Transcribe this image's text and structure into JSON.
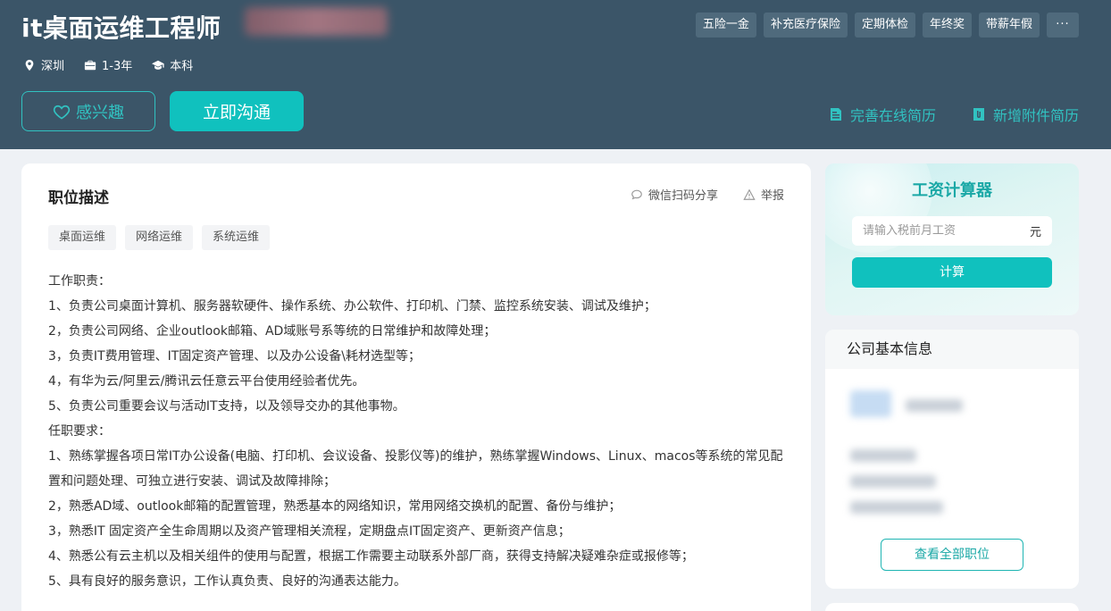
{
  "header": {
    "title": "it桌面运维工程师",
    "meta": {
      "location": "深圳",
      "experience": "1-3年",
      "education": "本科"
    },
    "benefit_tags": [
      "五险一金",
      "补充医疗保险",
      "定期体检",
      "年终奖",
      "带薪年假"
    ],
    "more_label": "···",
    "interest_label": "感兴趣",
    "chat_label": "立即沟通",
    "complete_resume_label": "完善在线简历",
    "add_attachment_label": "新增附件简历"
  },
  "job": {
    "section_title": "职位描述",
    "share_label": "微信扫码分享",
    "report_label": "举报",
    "skill_tags": [
      "桌面运维",
      "网络运维",
      "系统运维"
    ],
    "description": [
      "工作职责：",
      "1、负责公司桌面计算机、服务器软硬件、操作系统、办公软件、打印机、门禁、监控系统安装、调试及维护；",
      "2，负责公司网络、企业outlook邮箱、AD域账号系等统的日常维护和故障处理；",
      "3，负责IT费用管理、IT固定资产管理、以及办公设备\\耗材选型等；",
      "4，有华为云/阿里云/腾讯云任意云平台使用经验者优先。",
      "5、负责公司重要会议与活动IT支持，以及领导交办的其他事物。",
      "任职要求：",
      "1、熟练掌握各项日常IT办公设备(电脑、打印机、会议设备、投影仪等)的维护，熟练掌握Windows、Linux、macos等系统的常见配置和问题处理、可独立进行安装、调试及故障排除；",
      "2，熟悉AD域、outlook邮箱的配置管理，熟悉基本的网络知识，常用网络交换机的配置、备份与维护；",
      "3，熟悉IT 固定资产全生命周期以及资产管理相关流程，定期盘点IT固定资产、更新资产信息；",
      "4、熟悉公有云主机以及相关组件的使用与配置，根据工作需要主动联系外部厂商，获得支持解决疑难杂症或报修等；",
      "5、具有良好的服务意识，工作认真负责、良好的沟通表达能力。"
    ]
  },
  "calculator": {
    "title": "工资计算器",
    "placeholder": "请输入税前月工资",
    "unit": "元",
    "button_label": "计算"
  },
  "company": {
    "section_title": "公司基本信息",
    "view_all_label": "查看全部职位"
  },
  "colors": {
    "header_bg": "#3b5568",
    "accent": "#10c1be",
    "page_bg": "#eef1f5"
  }
}
